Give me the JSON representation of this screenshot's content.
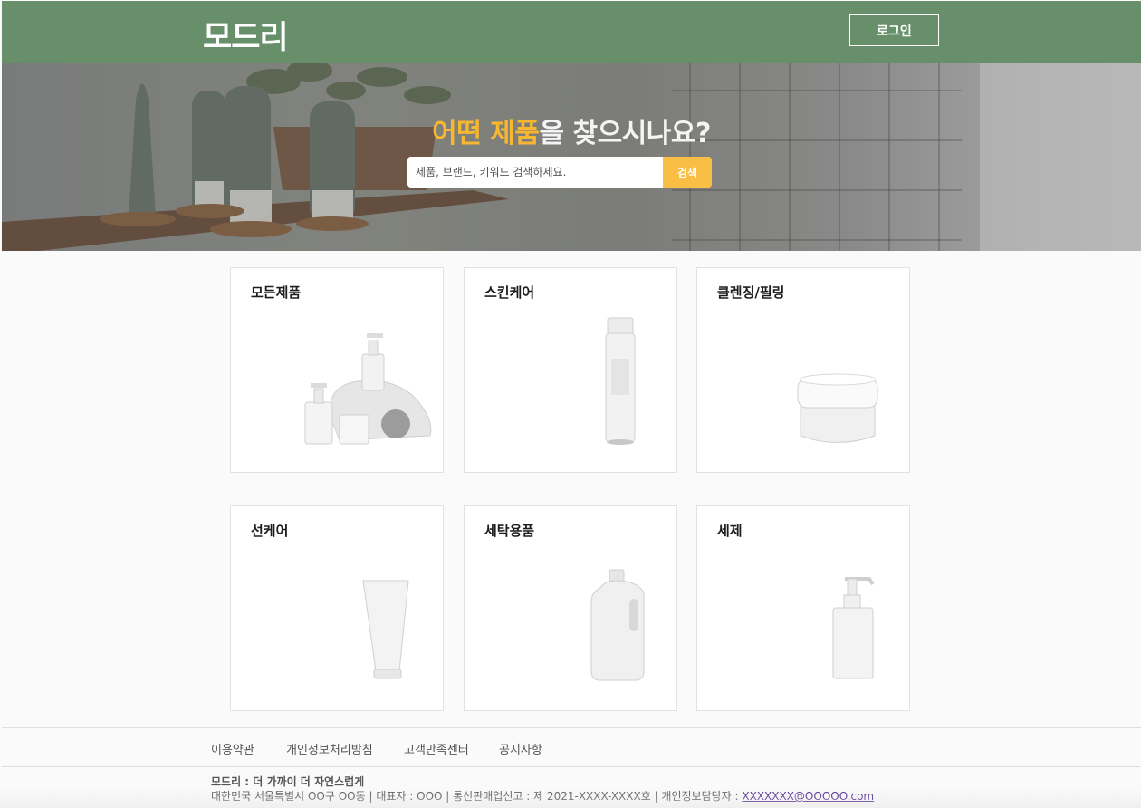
{
  "header": {
    "logo": "모드리",
    "login_label": "로그인"
  },
  "hero": {
    "title_accent": "어떤 제품",
    "title_rest": "을 찾으시나요?",
    "search_placeholder": "제품, 브랜드, 키워드 검색하세요.",
    "search_button": "검색"
  },
  "categories": [
    {
      "label": "모든제품",
      "icon": "product-set-image"
    },
    {
      "label": "스킨케어",
      "icon": "pump-bottle-image"
    },
    {
      "label": "클렌징/필링",
      "icon": "cream-jar-image"
    },
    {
      "label": "선케어",
      "icon": "tube-image"
    },
    {
      "label": "세탁용품",
      "icon": "detergent-jug-image"
    },
    {
      "label": "세제",
      "icon": "soap-dispenser-image"
    }
  ],
  "footer": {
    "links": [
      "이용약관",
      "개인정보처리방침",
      "고객만족센터",
      "공지사항"
    ],
    "brand_line": "모드리 : 더 가까이 더 자연스럽게",
    "info_line": "대한민국 서울특별시 OO구 OO동 | 대표자 : OOO | 통신판매업신고 : 제 2021-XXXX-XXXX호 | 개인정보담당자 : ",
    "email": "XXXXXXX@OOOOO.com"
  },
  "colors": {
    "header_bg": "#67906a",
    "accent": "#f7b733",
    "search_button_bg": "#f8be45"
  }
}
